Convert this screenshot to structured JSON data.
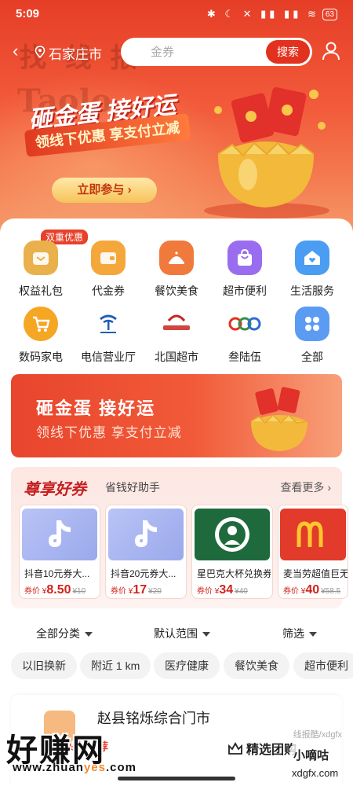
{
  "status": {
    "time": "5:09",
    "icons": "✱ ☾ ✕ ▮▮ ▮▮ ≋",
    "battery": "63"
  },
  "header": {
    "city": "石家庄市",
    "search_placeholder": "金券",
    "search_button": "搜索"
  },
  "watermarks": {
    "top_text": "找 线 报",
    "top_latin": "Taolo",
    "bottom_text": "好赚网",
    "bottom_url_pre": "www.zhuan",
    "bottom_url_y": "yes",
    "bottom_url_post": ".com",
    "right_text": "小嘀咕",
    "right_url": "xdgfx.com",
    "store_wm": "线报酷/xdgfx"
  },
  "hero": {
    "title": "砸金蛋 接好运",
    "ribbon": "领线下优惠 享支付立减",
    "join_button": "立即参与 ›"
  },
  "grid": {
    "badge": "双重优惠",
    "items": [
      {
        "label": "权益礼包",
        "icon": "gift-icon",
        "color": "#e9b04c"
      },
      {
        "label": "代金券",
        "icon": "wallet-icon",
        "color": "#f4a73a"
      },
      {
        "label": "餐饮美食",
        "icon": "dish-icon",
        "color": "#f07a3c"
      },
      {
        "label": "超市便利",
        "icon": "shopping-bag-icon",
        "color": "#9a6df0"
      },
      {
        "label": "生活服务",
        "icon": "home-heart-icon",
        "color": "#4a9df2"
      },
      {
        "label": "数码家电",
        "icon": "cart-icon",
        "color": "#f5a623"
      },
      {
        "label": "电信营业厅",
        "icon": "china-telecom-logo",
        "color": "#1f5fb5"
      },
      {
        "label": "北国超市",
        "icon": "beiguo-logo",
        "color": "#c8241d"
      },
      {
        "label": "叁陆伍",
        "icon": "365-logo",
        "color": "#3a8c4a"
      },
      {
        "label": "全部",
        "icon": "grid-icon",
        "color": "#5b9cf2"
      }
    ]
  },
  "banner2": {
    "title": "砸金蛋 接好运",
    "subtitle": "领线下优惠 享支付立减"
  },
  "coupons": {
    "title": "尊享好券",
    "subtitle": "省钱好助手",
    "more": "查看更多 ›",
    "price_label": "券价 ¥",
    "items": [
      {
        "name": "抖音10元券大...",
        "price": "8.50",
        "old": "¥10",
        "icon": "tiktok-icon",
        "color": "#a7b7ef"
      },
      {
        "name": "抖音20元券大...",
        "price": "17",
        "old": "¥20",
        "icon": "tiktok-icon",
        "color": "#a7b7ef"
      },
      {
        "name": "星巴克大杯兑换券",
        "price": "34",
        "old": "¥40",
        "icon": "starbucks-icon",
        "color": "#1f6a3d"
      },
      {
        "name": "麦当劳超值巨无",
        "price": "40",
        "old": "¥58.5",
        "icon": "mcdonalds-icon",
        "color": "#e23a2b"
      }
    ]
  },
  "filters": {
    "category": "全部分类",
    "range": "默认范围",
    "sort": "筛选"
  },
  "chips": [
    "以旧换新",
    "附近 1 km",
    "医疗健康",
    "餐饮美食",
    "超市便利"
  ],
  "store": {
    "name": "赵县铭烁综合门市",
    "tag": "头条推荐",
    "select_group": "精选团购"
  }
}
